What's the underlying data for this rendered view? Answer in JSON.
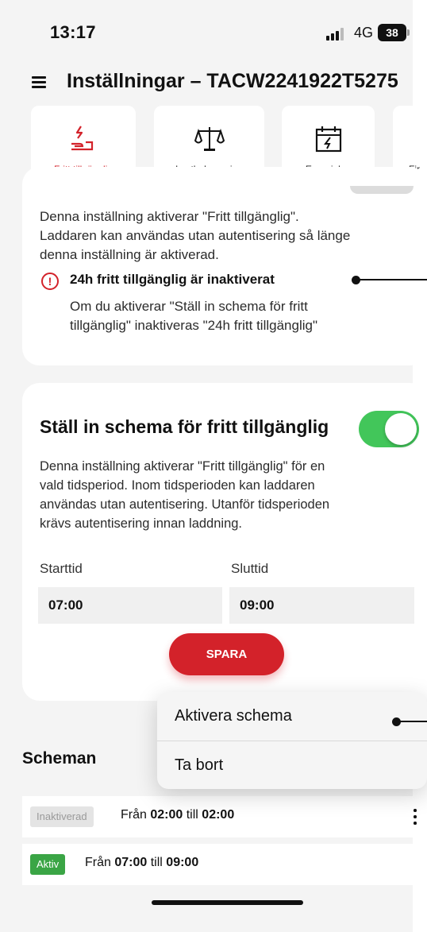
{
  "status_bar": {
    "time": "13:17",
    "network": "4G",
    "battery": "38"
  },
  "header": {
    "title": "Inställningar – TACW2241922T5275"
  },
  "tabs": [
    {
      "label": "Fritt tillgänglig",
      "icon": "hand-charge-icon",
      "active": true
    },
    {
      "label": "Lastbalansering",
      "icon": "balance-scale-icon"
    },
    {
      "label": "Energiplan",
      "icon": "calendar-bolt-icon"
    },
    {
      "label": "Fir",
      "icon": "partial-tab-icon"
    }
  ],
  "free_access_card": {
    "description_lines": [
      "Denna inställning aktiverar \"Fritt tillgänglig\".",
      "Laddaren kan användas utan autentisering så länge",
      "denna inställning är aktiverad."
    ],
    "warning_title": "24h fritt tillgänglig är inaktiverat",
    "warning_lines": [
      "Om du aktiverar \"Ställ in schema för fritt",
      "tillgänglig\" inaktiveras \"24h fritt tillgänglig\""
    ]
  },
  "schedule_card": {
    "title": "Ställ in schema för fritt tillgänglig",
    "toggle_on": true,
    "description_lines": [
      "Denna inställning aktiverar \"Fritt tillgänglig\" för en",
      "vald tidsperiod. Inom tidsperioden kan laddaren",
      "användas utan autentisering. Utanför tidsperioden",
      "krävs autentisering innan laddning."
    ],
    "start_label": "Starttid",
    "start_value": "07:00",
    "end_label": "Sluttid",
    "end_value": "09:00",
    "save_label": "SPARA"
  },
  "context_menu": {
    "items": [
      "Aktivera schema",
      "Ta bort"
    ]
  },
  "schedules": {
    "heading": "Scheman",
    "rows": [
      {
        "badge": "Inaktiverad",
        "from_word": "Från",
        "from": "02:00",
        "to_word": "till",
        "to": "02:00"
      },
      {
        "badge": "Aktiv",
        "from_word": "Från",
        "from": "07:00",
        "to_word": "till",
        "to": "09:00"
      }
    ]
  },
  "colors": {
    "accent": "#d3222a",
    "toggle_on": "#42c65a",
    "badge_active": "#3aa545"
  }
}
